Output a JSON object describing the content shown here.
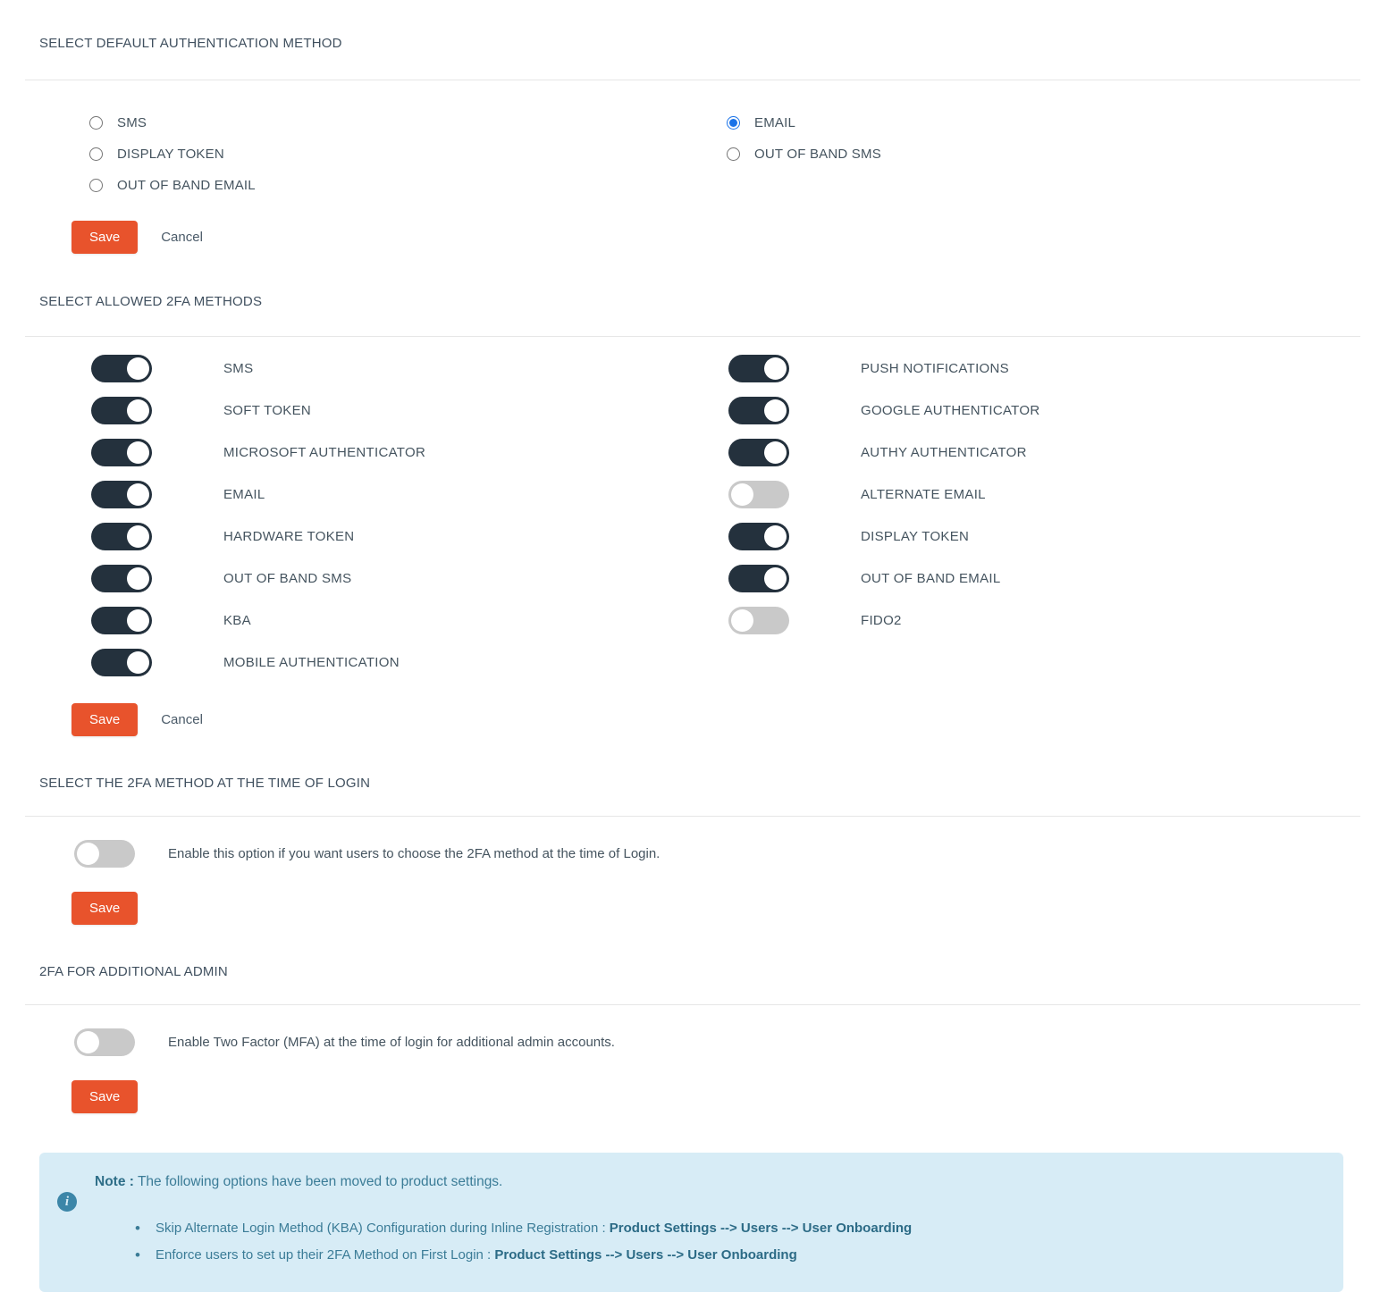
{
  "sections": {
    "default_method": {
      "title": "SELECT DEFAULT AUTHENTICATION METHOD",
      "options_left": [
        {
          "label": "SMS",
          "selected": false
        },
        {
          "label": "DISPLAY TOKEN",
          "selected": false
        },
        {
          "label": "OUT OF BAND EMAIL",
          "selected": false
        }
      ],
      "options_right": [
        {
          "label": "EMAIL",
          "selected": true
        },
        {
          "label": "OUT OF BAND SMS",
          "selected": false
        }
      ],
      "save_label": "Save",
      "cancel_label": "Cancel"
    },
    "allowed_methods": {
      "title": "SELECT ALLOWED 2FA METHODS",
      "toggles_left": [
        {
          "label": "SMS",
          "on": true
        },
        {
          "label": "SOFT TOKEN",
          "on": true
        },
        {
          "label": "MICROSOFT AUTHENTICATOR",
          "on": true
        },
        {
          "label": "EMAIL",
          "on": true
        },
        {
          "label": "HARDWARE TOKEN",
          "on": true
        },
        {
          "label": "OUT OF BAND SMS",
          "on": true
        },
        {
          "label": "KBA",
          "on": true
        },
        {
          "label": "MOBILE AUTHENTICATION",
          "on": true
        }
      ],
      "toggles_right": [
        {
          "label": "PUSH NOTIFICATIONS",
          "on": true
        },
        {
          "label": "GOOGLE AUTHENTICATOR",
          "on": true
        },
        {
          "label": "AUTHY AUTHENTICATOR",
          "on": true
        },
        {
          "label": "ALTERNATE EMAIL",
          "on": false
        },
        {
          "label": "DISPLAY TOKEN",
          "on": true
        },
        {
          "label": "OUT OF BAND EMAIL",
          "on": true
        },
        {
          "label": "FIDO2",
          "on": false
        }
      ],
      "save_label": "Save",
      "cancel_label": "Cancel"
    },
    "method_at_login": {
      "title": "SELECT THE 2FA METHOD AT THE TIME OF LOGIN",
      "toggle": {
        "label": "Enable this option if you want users to choose the 2FA method at the time of Login.",
        "on": false
      },
      "save_label": "Save"
    },
    "additional_admin": {
      "title": "2FA FOR ADDITIONAL ADMIN",
      "toggle": {
        "label": "Enable Two Factor (MFA) at the time of login for additional admin accounts.",
        "on": false
      },
      "save_label": "Save"
    }
  },
  "note": {
    "icon": "info-icon",
    "label": "Note :",
    "text": " The following options have been moved to product settings.",
    "items": [
      {
        "text": "Skip Alternate Login Method (KBA) Configuration during Inline Registration : ",
        "path": "Product Settings --> Users --> User Onboarding"
      },
      {
        "text": "Enforce users to set up their 2FA Method on First Login : ",
        "path": "Product Settings --> Users --> User Onboarding"
      }
    ]
  },
  "colors": {
    "accent": "#e8532c",
    "toggle_on": "#24313d",
    "toggle_off": "#c9c9c9",
    "note_bg": "#d7ecf6",
    "radio_selected": "#1a73e8"
  }
}
